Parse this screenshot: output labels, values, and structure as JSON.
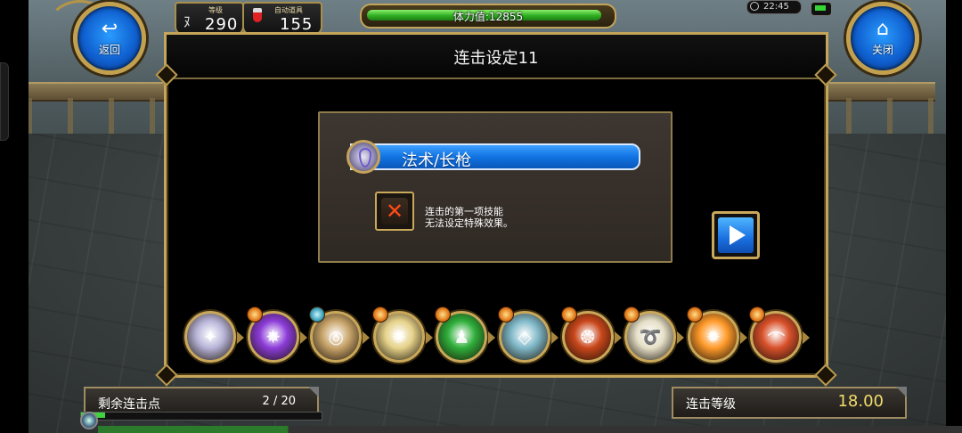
{
  "hud": {
    "level_label": "等级",
    "level_value": "290",
    "potion_label": "自动道具",
    "potion_value": "155",
    "stamina_label": "体力值:12855",
    "stamina_fill": 0.98,
    "clock": "22:45"
  },
  "nav": {
    "back_label": "返回",
    "close_label": "关闭"
  },
  "panel": {
    "title": "连击设定11",
    "skill_name": "法术/长枪",
    "remove_icon": "x-icon",
    "note_line1": "连击的第一项技能",
    "note_line2": "无法设定特殊效果。"
  },
  "chain": {
    "skills": [
      {
        "icon": "lance-skill-icon",
        "badge": "none",
        "color": "#b8b4d8"
      },
      {
        "icon": "purple-comet-skill-icon",
        "badge": "orange",
        "color": "#8c3cd8"
      },
      {
        "icon": "cage-skill-icon",
        "badge": "teal",
        "color": "#c8a46a"
      },
      {
        "icon": "burst-skill-icon",
        "badge": "orange",
        "color": "#e6d28a"
      },
      {
        "icon": "green-figure-skill-icon",
        "badge": "orange",
        "color": "#2fae3a"
      },
      {
        "icon": "crystal-skill-icon",
        "badge": "orange",
        "color": "#7fb8c8"
      },
      {
        "icon": "fire-cat-skill-icon",
        "badge": "orange",
        "color": "#c8461a"
      },
      {
        "icon": "spiral-skill-icon",
        "badge": "orange",
        "color": "#e6e0c8"
      },
      {
        "icon": "sun-burst-skill-icon",
        "badge": "orange",
        "color": "#ff9a2a"
      },
      {
        "icon": "flame-dome-skill-icon",
        "badge": "orange",
        "color": "#d8502a"
      }
    ]
  },
  "footer": {
    "combo_points_label": "剩余连击点",
    "combo_points_value": "2 / 20",
    "combo_level_label": "连击等级",
    "combo_level_value": "18.00",
    "xp_fill": 0.1
  }
}
